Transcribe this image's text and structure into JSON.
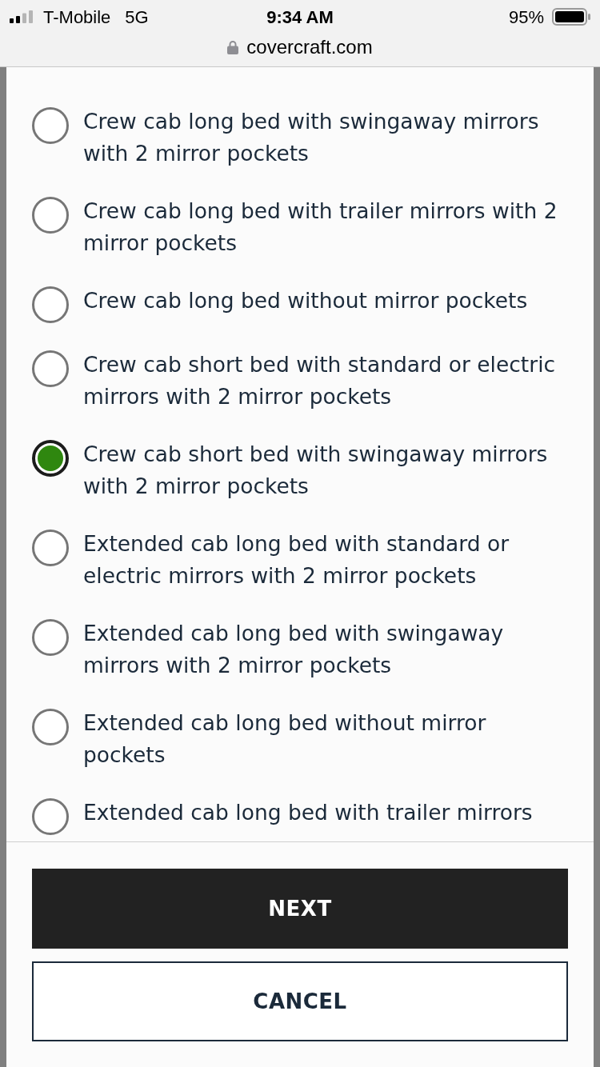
{
  "status_bar": {
    "carrier": "T-Mobile",
    "network": "5G",
    "time": "9:34 AM",
    "battery": "95%"
  },
  "address_bar": {
    "url": "covercraft.com"
  },
  "options": [
    {
      "label": "Crew cab long bed with swingaway mirrors with 2 mirror pockets",
      "selected": false
    },
    {
      "label": "Crew cab long bed with trailer mirrors with 2 mirror pockets",
      "selected": false
    },
    {
      "label": "Crew cab long bed without mirror pockets",
      "selected": false
    },
    {
      "label": "Crew cab short bed with standard or electric mirrors with 2 mirror pockets",
      "selected": false
    },
    {
      "label": "Crew cab short bed with swingaway mirrors with 2 mirror pockets",
      "selected": true
    },
    {
      "label": "Extended cab long bed with standard or electric mirrors with 2 mirror pockets",
      "selected": false
    },
    {
      "label": "Extended cab long bed with swingaway mirrors with 2 mirror pockets",
      "selected": false
    },
    {
      "label": "Extended cab long bed without mirror pockets",
      "selected": false
    },
    {
      "label": "Extended cab long bed with trailer mirrors",
      "selected": false
    }
  ],
  "buttons": [
    {
      "label": "NEXT",
      "kind": "primary"
    },
    {
      "label": "CANCEL",
      "kind": "secondary"
    }
  ]
}
